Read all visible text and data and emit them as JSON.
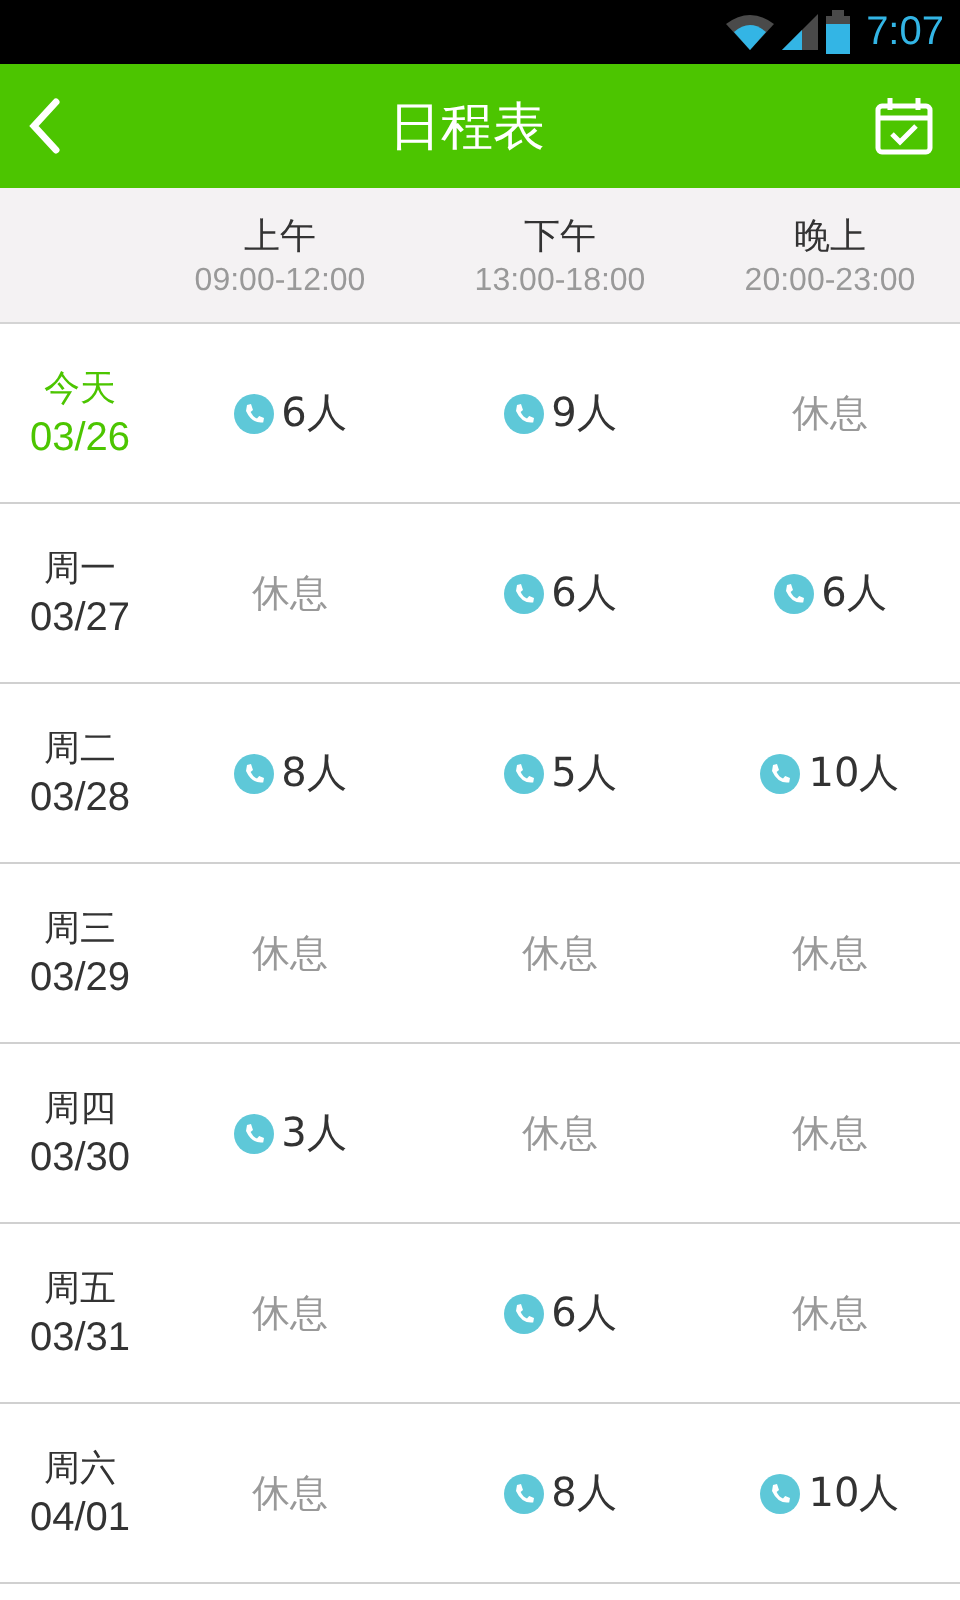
{
  "status_bar": {
    "time": "7:07"
  },
  "app_bar": {
    "title": "日程表"
  },
  "columns": [
    {
      "name": "上午",
      "hours": "09:00-12:00"
    },
    {
      "name": "下午",
      "hours": "13:00-18:00"
    },
    {
      "name": "晚上",
      "hours": "20:00-23:00"
    }
  ],
  "days": [
    {
      "day": "今天",
      "date": "03/26",
      "today": true,
      "slots": [
        {
          "kind": "booked",
          "text": "6人"
        },
        {
          "kind": "booked",
          "text": "9人"
        },
        {
          "kind": "rest",
          "text": "休息"
        }
      ]
    },
    {
      "day": "周一",
      "date": "03/27",
      "today": false,
      "slots": [
        {
          "kind": "rest",
          "text": "休息"
        },
        {
          "kind": "booked",
          "text": "6人"
        },
        {
          "kind": "booked",
          "text": "6人"
        }
      ]
    },
    {
      "day": "周二",
      "date": "03/28",
      "today": false,
      "slots": [
        {
          "kind": "booked",
          "text": "8人"
        },
        {
          "kind": "booked",
          "text": "5人"
        },
        {
          "kind": "booked",
          "text": "10人"
        }
      ]
    },
    {
      "day": "周三",
      "date": "03/29",
      "today": false,
      "slots": [
        {
          "kind": "rest",
          "text": "休息"
        },
        {
          "kind": "rest",
          "text": "休息"
        },
        {
          "kind": "rest",
          "text": "休息"
        }
      ]
    },
    {
      "day": "周四",
      "date": "03/30",
      "today": false,
      "slots": [
        {
          "kind": "booked",
          "text": "3人"
        },
        {
          "kind": "rest",
          "text": "休息"
        },
        {
          "kind": "rest",
          "text": "休息"
        }
      ]
    },
    {
      "day": "周五",
      "date": "03/31",
      "today": false,
      "slots": [
        {
          "kind": "rest",
          "text": "休息"
        },
        {
          "kind": "booked",
          "text": "6人"
        },
        {
          "kind": "rest",
          "text": "休息"
        }
      ]
    },
    {
      "day": "周六",
      "date": "04/01",
      "today": false,
      "slots": [
        {
          "kind": "rest",
          "text": "休息"
        },
        {
          "kind": "booked",
          "text": "8人"
        },
        {
          "kind": "booked",
          "text": "10人"
        }
      ]
    }
  ]
}
